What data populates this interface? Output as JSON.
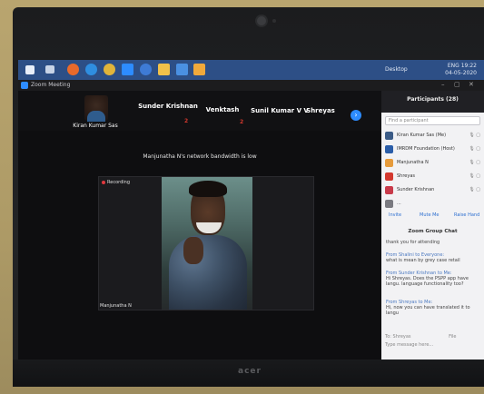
{
  "taskbar": {
    "desktop_label": "Desktop",
    "lang": "ENG",
    "time": "19:22",
    "date": "04-05-2020"
  },
  "window": {
    "title": "Zoom Meeting"
  },
  "gallery": {
    "participants": [
      "Kiran Kumar Sas",
      "Sunder Krishnan",
      "Venktash",
      "Sunil Kumar V V",
      "Shreyas"
    ],
    "marks": [
      "2",
      "2"
    ]
  },
  "main": {
    "bandwidth_notice": "Manjunatha N's network bandwidth is low",
    "recording_label": "Recording",
    "speaker_name": "Manjunatha N"
  },
  "panel": {
    "title": "Participants (28)",
    "search_placeholder": "Find a participant",
    "participants": [
      {
        "name": "Kiran Kumar Sas (Me)",
        "color": "#3b5b86",
        "icons": "🎙 ▢"
      },
      {
        "name": "IMRDM Foundation (Host)",
        "color": "#2a5da8",
        "icons": "🎙 ▢"
      },
      {
        "name": "Manjunatha N",
        "color": "#e69b3b",
        "icons": "🎙 ▢"
      },
      {
        "name": "Shreyas",
        "color": "#d3382e",
        "icons": "🎙 ▢"
      },
      {
        "name": "Sunder Krishnan",
        "color": "#c83a4a",
        "icons": "🎙 ▢"
      },
      {
        "name": "...",
        "color": "#7a7a80",
        "icons": ""
      }
    ],
    "actions": [
      "Invite",
      "Mute Me",
      "Raise Hand"
    ],
    "chat_title": "Zoom Group Chat",
    "chat": [
      {
        "from": "",
        "msg": "thank you for attending"
      },
      {
        "from": "From Shalini to Everyone:",
        "msg": "what is mean by grey case retail"
      },
      {
        "from": "From Sunder Krishnan to Me:",
        "msg": "Hi Shreyas. Does the PSPP app have langu. language functionality too?"
      },
      {
        "from": "From Shreyas to Me:",
        "msg": "Hi, now you can have translated it to langu"
      }
    ],
    "chat_to": "To: Shreyas",
    "chat_file": "File",
    "chat_placeholder": "Type message here..."
  },
  "brand": "acer"
}
